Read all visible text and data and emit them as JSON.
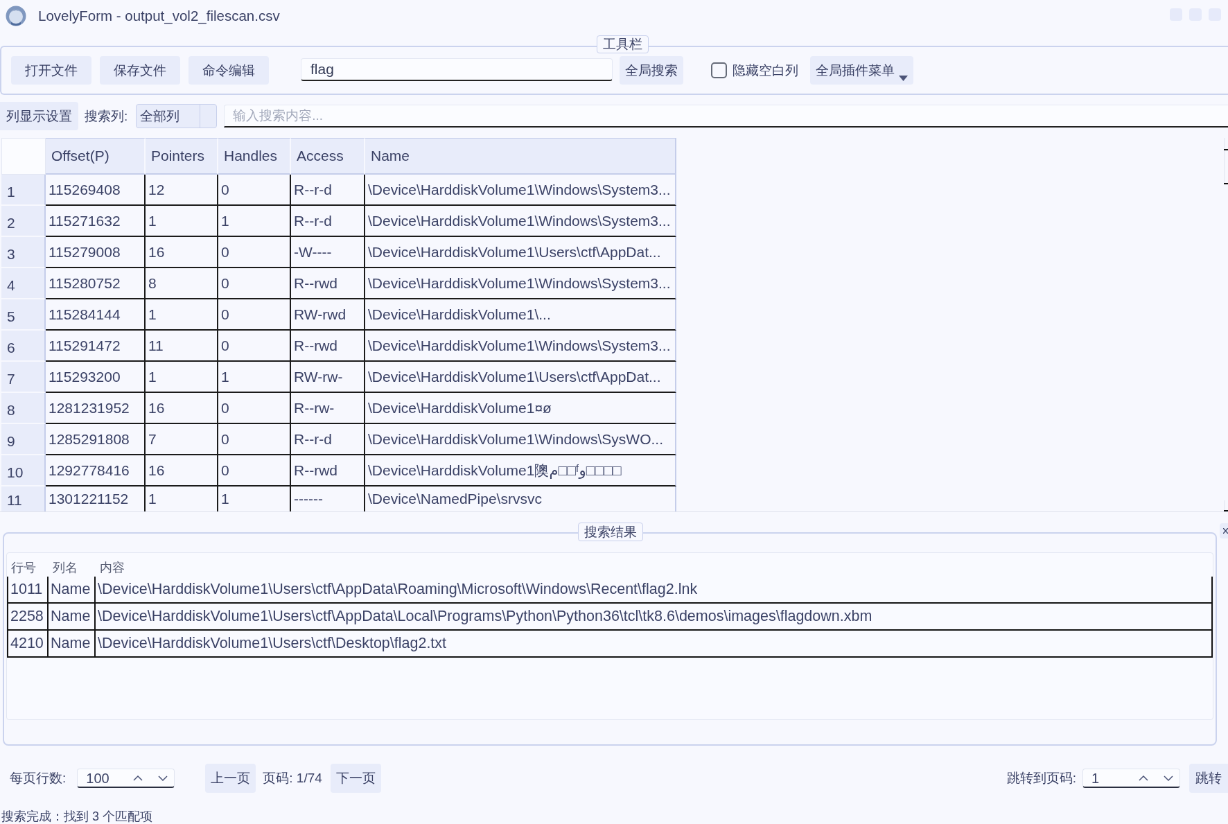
{
  "window": {
    "title": "LovelyForm - output_vol2_filescan.csv"
  },
  "toolbar": {
    "title": "工具栏",
    "buttons": [
      "打开文件",
      "保存文件",
      "命令编辑"
    ],
    "search": {
      "value": "flag"
    },
    "search_button": "全局搜索",
    "hide_empty_columns": {
      "label": "隐藏空白列",
      "checked": false
    },
    "plugin_menu": {
      "label": "全局插件菜单"
    }
  },
  "filter_bar": {
    "column_settings_button": "列显示设置",
    "search_column_label": "搜索列:",
    "search_column": {
      "value": "全部列"
    },
    "search": {
      "placeholder": "输入搜索内容..."
    }
  },
  "table": {
    "columns": [
      "Offset(P)",
      "Pointers",
      "Handles",
      "Access",
      "Name"
    ],
    "rows": [
      {
        "number": "1",
        "cells": [
          "115269408",
          "12",
          "0",
          "R--r-d",
          "\\Device\\HarddiskVolume1\\Windows\\System3..."
        ]
      },
      {
        "number": "2",
        "cells": [
          "115271632",
          "1",
          "1",
          "R--r-d",
          "\\Device\\HarddiskVolume1\\Windows\\System3..."
        ]
      },
      {
        "number": "3",
        "cells": [
          "115279008",
          "16",
          "0",
          "-W----",
          "\\Device\\HarddiskVolume1\\Users\\ctf\\AppDat..."
        ]
      },
      {
        "number": "4",
        "cells": [
          "115280752",
          "8",
          "0",
          "R--rwd",
          "\\Device\\HarddiskVolume1\\Windows\\System3..."
        ]
      },
      {
        "number": "5",
        "cells": [
          "115284144",
          "1",
          "0",
          "RW-rwd",
          "\\Device\\HarddiskVolume1\\..."
        ]
      },
      {
        "number": "6",
        "cells": [
          "115291472",
          "11",
          "0",
          "R--rwd",
          "\\Device\\HarddiskVolume1\\Windows\\System3..."
        ]
      },
      {
        "number": "7",
        "cells": [
          "115293200",
          "1",
          "1",
          "RW-rw-",
          "\\Device\\HarddiskVolume1\\Users\\ctf\\AppDat..."
        ]
      },
      {
        "number": "8",
        "cells": [
          "1281231952",
          "16",
          "0",
          "R--rw-",
          "\\Device\\HarddiskVolume1¤ø"
        ]
      },
      {
        "number": "9",
        "cells": [
          "1285291808",
          "7",
          "0",
          "R--r-d",
          "\\Device\\HarddiskVolume1\\Windows\\SysWO..."
        ]
      },
      {
        "number": "10",
        "cells": [
          "1292778416",
          "16",
          "0",
          "R--rwd",
          "\\Device\\HarddiskVolume1隩م□□ᶠو□□□□"
        ]
      },
      {
        "number": "11",
        "cells": [
          "1301221152",
          "1",
          "1",
          "------",
          "\\Device\\NamedPipe\\srvsvc"
        ]
      }
    ]
  },
  "search_results": {
    "title": "搜索结果",
    "columns": [
      "行号",
      "列名",
      "内容"
    ],
    "rows": [
      [
        "1011",
        "Name",
        "\\Device\\HarddiskVolume1\\Users\\ctf\\AppData\\Roaming\\Microsoft\\Windows\\Recent\\flag2.lnk"
      ],
      [
        "2258",
        "Name",
        "\\Device\\HarddiskVolume1\\Users\\ctf\\AppData\\Local\\Programs\\Python\\Python36\\tcl\\tk8.6\\demos\\images\\flagdown.xbm"
      ],
      [
        "4210",
        "Name",
        "\\Device\\HarddiskVolume1\\Users\\ctf\\Desktop\\flag2.txt"
      ]
    ]
  },
  "pagination": {
    "rows_per_page_label": "每页行数:",
    "rows_per_page": "100",
    "prev_button": "上一页",
    "page_label": "页码: 1/74",
    "next_button": "下一页",
    "jump_label": "跳转到页码:",
    "jump_page": "1",
    "jump_button": "跳转"
  },
  "status_bar": {
    "text": "搜索完成：找到 3 个匹配项"
  }
}
